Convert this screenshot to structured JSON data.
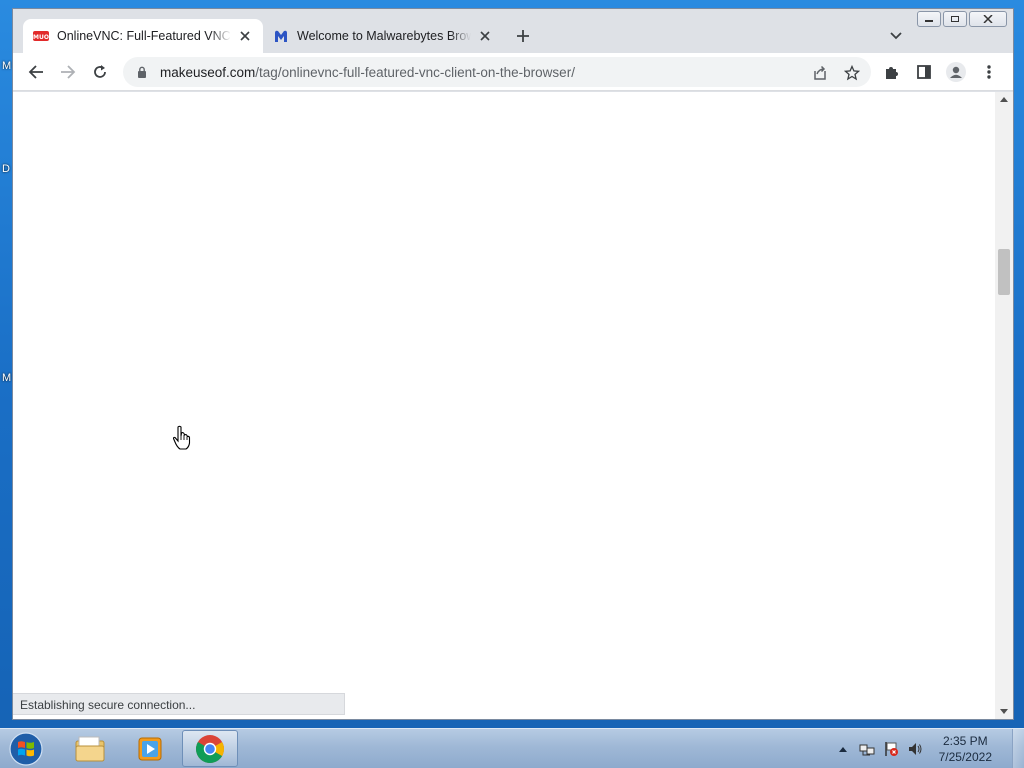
{
  "desktop": {
    "letters": [
      "M",
      "D",
      "M"
    ]
  },
  "browser": {
    "tabs": [
      {
        "title": "OnlineVNC: Full-Featured VNC Cl",
        "active": true,
        "favicon": "muo-icon"
      },
      {
        "title": "Welcome to Malwarebytes Brows",
        "active": false,
        "favicon": "malwarebytes-icon"
      }
    ],
    "omnibox": {
      "domain": "makeuseof.com",
      "path": "/tag/onlinevnc-full-featured-vnc-client-on-the-browser/"
    },
    "status_text": "Establishing secure connection...",
    "accent": "#1a73e8"
  },
  "taskbar": {
    "items": [
      "windows-explorer-icon",
      "media-player-icon",
      "chrome-icon"
    ],
    "clock": {
      "time": "2:35 PM",
      "date": "7/25/2022"
    }
  }
}
